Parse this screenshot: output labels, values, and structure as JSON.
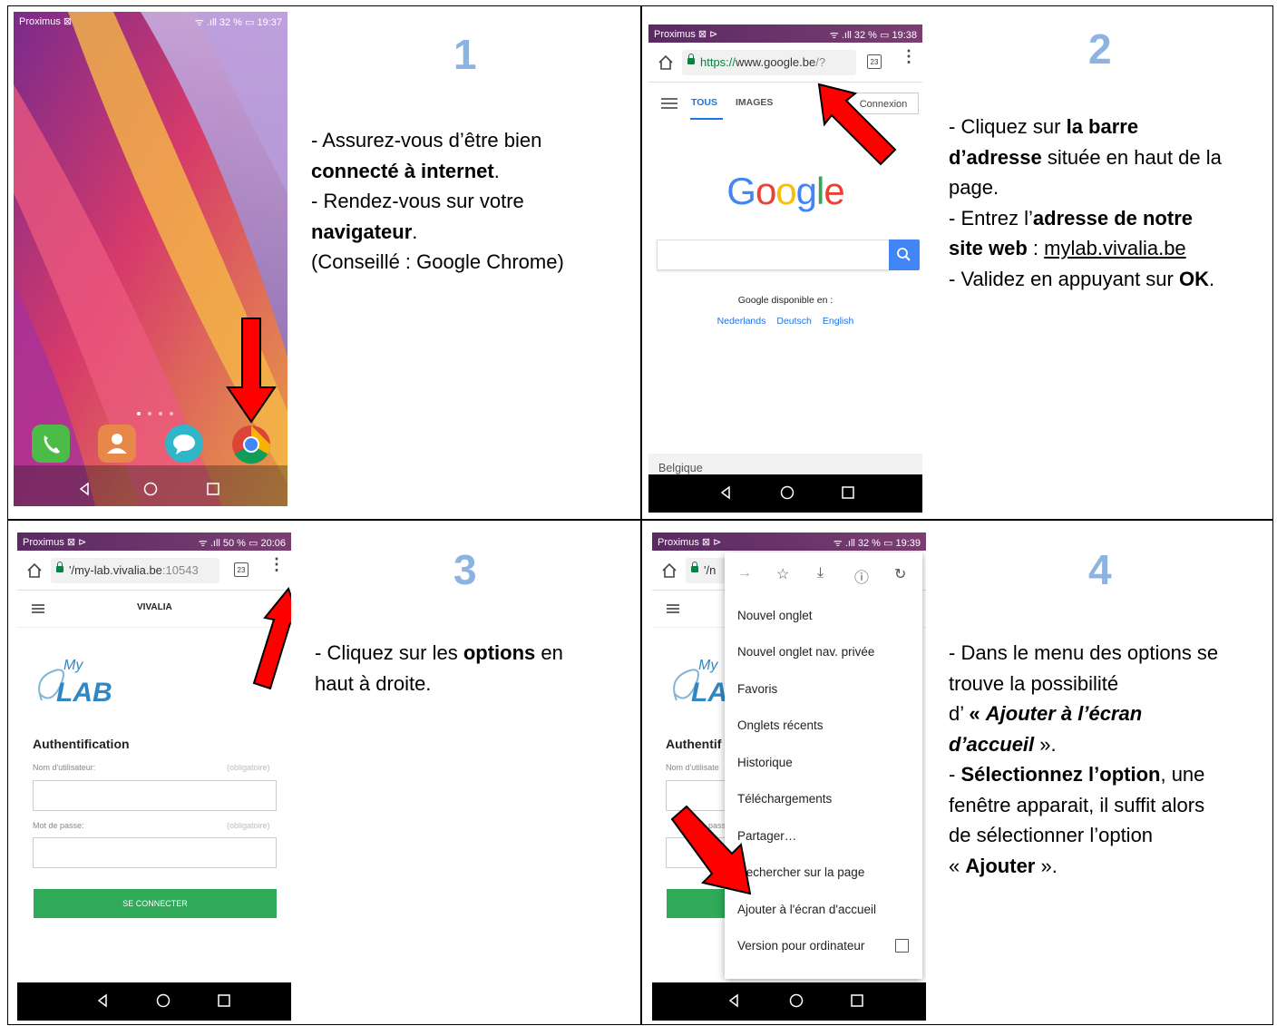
{
  "steps": [
    {
      "number": "1",
      "text": [
        [
          "- Assurez-vous d’être bien",
          ""
        ],
        [
          "connecté à internet",
          "."
        ],
        [
          "- Rendez-vous sur votre",
          ""
        ],
        [
          "navigateur",
          "."
        ],
        [
          "(Conseillé : Google Chrome)",
          ""
        ]
      ],
      "phone": {
        "carrier": "Proximus ⊠",
        "status_right": "ᯤ .ıll 32 % ▭ 19:37"
      }
    },
    {
      "number": "2",
      "lines": {
        "l1_pre": "- Cliquez sur ",
        "l1_bold": "la barre",
        "l2_bold": "d’adresse",
        "l2_post": " située en haut de la",
        "l3": "page.",
        "l4_pre": "- Entrez l’",
        "l4_bold": "adresse de notre",
        "l5_bold": "site web",
        "l5_mid": " : ",
        "l5_link": "mylab.vivalia.be",
        "l6_pre": "- Validez en appuyant sur ",
        "l6_bold": "OK",
        "l6_post": "."
      },
      "phone": {
        "carrier": "Proximus ⊠ ⊳",
        "status_right": "ᯤ .ıll 32 % ▭ 19:38",
        "url_scheme": "https://",
        "url_host": "www.google.be",
        "url_rest": "/?",
        "tab_count": "23",
        "tabs": [
          "TOUS",
          "IMAGES"
        ],
        "login": "Connexion",
        "logo": [
          "G",
          "o",
          "o",
          "g",
          "l",
          "e"
        ],
        "logo_colors": [
          "#4285f4",
          "#ea4335",
          "#fbbc05",
          "#4285f4",
          "#34a853",
          "#ea4335"
        ],
        "available": "Google disponible en :",
        "langs": [
          "Nederlands",
          "Deutsch",
          "English"
        ],
        "country": "Belgique"
      }
    },
    {
      "number": "3",
      "lines": {
        "l1_pre": "- Cliquez sur les ",
        "l1_bold": "options",
        "l1_post": " en",
        "l2": "haut à droite."
      },
      "phone": {
        "carrier": "Proximus ⊠ ⊳",
        "status_right": "ᯤ .ıll 50 % ▭ 20:06",
        "url": "'/my-lab.vivalia.be",
        "url_port": ":10543",
        "tab_count": "23",
        "site_title": "VIVALIA",
        "logo_my": "My",
        "logo_lab": "LAB",
        "auth_title": "Authentification",
        "user_label": "Nom d'utilisateur:",
        "pass_label": "Mot de passe:",
        "required": "(obligatoire)",
        "connect": "SE CONNECTER"
      }
    },
    {
      "number": "4",
      "lines": {
        "l1": "- Dans le menu des options se",
        "l2": "trouve la possibilité",
        "l3_pre": "d’ ",
        "l3_bold": "« ",
        "l3_bi": "Ajouter à l’écran",
        "l4_bi": "d’accueil",
        "l4_post": " ».",
        "l5_pre": "- ",
        "l5_bold": "Sélectionnez l’option",
        "l5_post": ", une",
        "l6": "fenêtre apparait, il suffit alors",
        "l7": "de sélectionner l’option",
        "l8_pre": "« ",
        "l8_bold": "Ajouter",
        "l8_post": " »."
      },
      "phone": {
        "carrier": "Proximus ⊠ ⊳",
        "status_right": "ᯤ .ıll 32 % ▭ 19:39",
        "url_partial": "'/n",
        "auth_partial": "Authentif",
        "user_partial": "Nom d'utilisate",
        "pass_partial": "passe:",
        "menu_items": [
          "Nouvel onglet",
          "Nouvel onglet nav. privée",
          "Favoris",
          "Onglets récents",
          "Historique",
          "Téléchargements",
          "Partager…",
          "Rechercher sur la page",
          "Ajouter à l'écran d'accueil",
          "Version pour ordinateur"
        ]
      }
    }
  ],
  "colors": {
    "step_number": "#8db3e2",
    "arrow": "#ff0000",
    "chrome_bar": "#6a3c6e",
    "green_button": "#2eaa58"
  }
}
